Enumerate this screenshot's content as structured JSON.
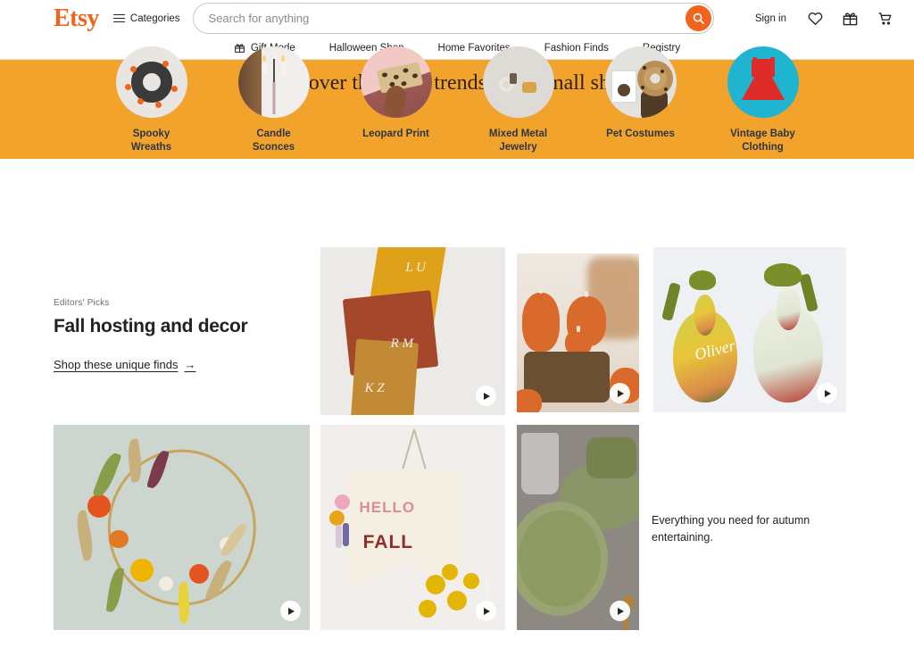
{
  "header": {
    "logo": "Etsy",
    "categories_label": "Categories",
    "search": {
      "placeholder": "Search for anything",
      "value": ""
    },
    "sign_in": "Sign in",
    "icons": [
      "search-icon",
      "favorites-heart-icon",
      "gift-icon",
      "cart-icon"
    ],
    "nav": [
      {
        "label": "Gift Mode",
        "icon": "gift-icon"
      },
      {
        "label": "Halloween Shop",
        "icon": ""
      },
      {
        "label": "Home Favorites",
        "icon": ""
      },
      {
        "label": "Fashion Finds",
        "icon": ""
      },
      {
        "label": "Registry",
        "icon": ""
      }
    ]
  },
  "banner": {
    "title": "Discover the latest trends from small shops.",
    "background_color": "#F1A32B",
    "categories": [
      {
        "label": "Spooky Wreaths",
        "line1": "Spooky",
        "line2": "Wreaths",
        "image": "halloween-wreath-photo"
      },
      {
        "label": "Candle Sconces",
        "line1": "Candle",
        "line2": "Sconces",
        "image": "candle-sconce-photo"
      },
      {
        "label": "Leopard Print",
        "line1": "Leopard Print",
        "line2": "",
        "image": "leopard-print-clutch-photo"
      },
      {
        "label": "Mixed Metal Jewelry",
        "line1": "Mixed Metal",
        "line2": "Jewelry",
        "image": "mixed-metal-jewelry-photo"
      },
      {
        "label": "Pet Costumes",
        "line1": "Pet Costumes",
        "line2": "",
        "image": "pet-donut-costume-photo"
      },
      {
        "label": "Vintage Baby Clothing",
        "line1": "Vintage Baby",
        "line2": "Clothing",
        "image": "red-baby-dress-photo"
      }
    ]
  },
  "editors_picks": {
    "eyebrow": "Editors' Picks",
    "title": "Fall hosting and decor",
    "link_label": "Shop these unique finds",
    "link_arrow": "→",
    "caption": "Everything you need for autumn entertaining.",
    "tiles": [
      {
        "name": "monogrammed-napkins",
        "alt": "Monogrammed linen napkins in mustard and rust",
        "has_video": true,
        "monograms": [
          "L U",
          "R M",
          "K Z"
        ]
      },
      {
        "name": "pumpkin-candles",
        "alt": "Orange pumpkin candles on a wood slice",
        "has_video": true
      },
      {
        "name": "decorative-pears",
        "alt": "Painted decorative pears with green ribbons, Oliver",
        "has_video": true,
        "script_text": "Oliver"
      },
      {
        "name": "dried-flower-wreath",
        "alt": "Dried flower hoop wreath on sage wall",
        "has_video": true
      },
      {
        "name": "hello-fall-banner",
        "alt": "HELLO FALL wall banner with pom poms",
        "has_video": true,
        "line1": "HELLO",
        "line2": "FALL"
      },
      {
        "name": "ceramic-plates",
        "alt": "Green textured ceramic plates and bowl",
        "has_video": true
      }
    ]
  },
  "colors": {
    "brand_orange": "#F1641E",
    "banner_orange": "#F1A32B",
    "text_dark": "#222222",
    "label_navy": "#2F3542"
  }
}
